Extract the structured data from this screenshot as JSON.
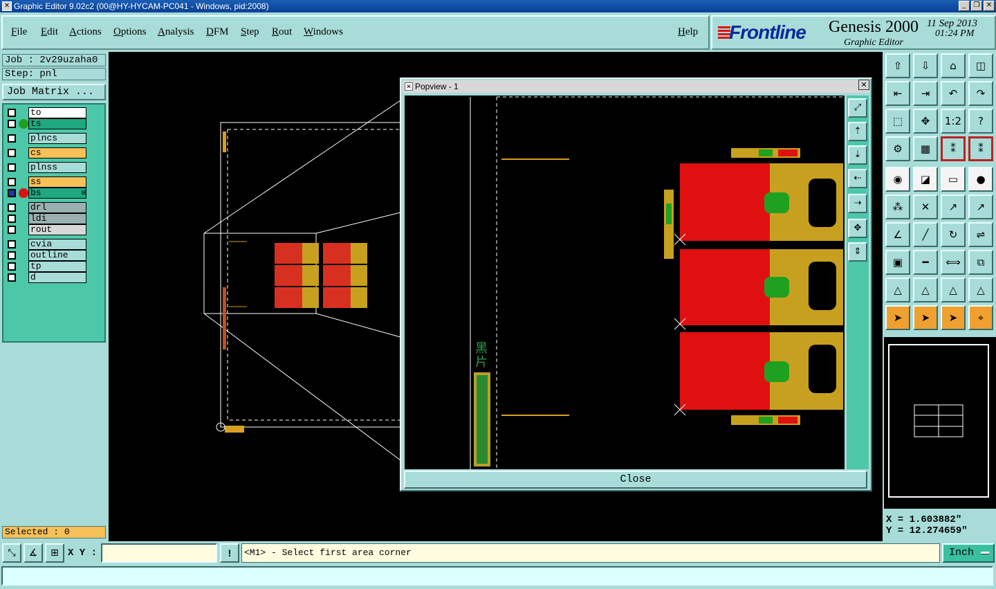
{
  "window": {
    "title": "Graphic Editor 9.02c2 (00@HY-HYCAM-PC041 - Windows, pid:2008)",
    "minimize": "_",
    "restore": "❐",
    "close": "✕"
  },
  "menu": {
    "items": [
      "File",
      "Edit",
      "Actions",
      "Options",
      "Analysis",
      "DFM",
      "Step",
      "Rout",
      "Windows"
    ],
    "help": "Help"
  },
  "logo": {
    "brand": "Frontline",
    "product": "Genesis 2000",
    "subtitle": "Graphic Editor",
    "date": "11 Sep 2013",
    "time": "01:24 PM"
  },
  "job": {
    "job_label": "Job : 2v29uzaha0",
    "step_label": "Step: pnl",
    "matrix_button": "Job Matrix ..."
  },
  "layers": [
    {
      "name": "to",
      "color": "#ffffff",
      "dot": ""
    },
    {
      "name": "ts",
      "color": "#20a880",
      "dot": "#20a020"
    },
    {
      "name": "plncs",
      "color": "#a8dcd8",
      "dot": ""
    },
    {
      "name": "cs",
      "color": "#f8c058",
      "dot": ""
    },
    {
      "name": "plnss",
      "color": "#a8dcd8",
      "dot": ""
    },
    {
      "name": "ss",
      "color": "#f8c058",
      "dot": ""
    },
    {
      "name": "bs",
      "color": "#20a880",
      "dot": "#e01010",
      "mark": "⊞"
    },
    {
      "name": "drl",
      "color": "#9ab0b0",
      "dot": ""
    },
    {
      "name": "ldi",
      "color": "#9ab0b0",
      "dot": ""
    },
    {
      "name": "rout",
      "color": "#d8d8d8",
      "dot": ""
    },
    {
      "name": "cvia",
      "color": "#a8dcd8",
      "dot": ""
    },
    {
      "name": "outline",
      "color": "#a8dcd8",
      "dot": ""
    },
    {
      "name": "tp",
      "color": "#a8dcd8",
      "dot": ""
    },
    {
      "name": "d",
      "color": "#a8dcd8",
      "dot": ""
    }
  ],
  "selected": "Selected : 0",
  "popview": {
    "title": "Popview - 1",
    "close_x": "✕",
    "close_button": "Close",
    "chinese_text": "黑片",
    "side_icons": [
      "zoom-fit",
      "zoom-in",
      "zoom-out",
      "pan-left",
      "pan-right",
      "fit-all",
      "fit-vertical"
    ]
  },
  "toolbox": {
    "icons": [
      "export",
      "import",
      "home",
      "window",
      "move-left",
      "move-right",
      "undo-step",
      "redo-step",
      "zoom-box",
      "zoom-center",
      "ratio",
      "help",
      "settings",
      "grid",
      "snap-a",
      "snap-b",
      "feature-add",
      "measure-draw",
      "ruler",
      "point",
      "node-edit",
      "cross",
      "arc-add",
      "arc-edit",
      "line-draw",
      "line-cut",
      "rotate",
      "mirror",
      "pad-add",
      "line-center",
      "dimension",
      "group",
      "triangle-a",
      "triangle-b",
      "triangle-c",
      "triangle-d",
      "select",
      "select-box",
      "select-poly",
      "select-net"
    ],
    "ratio_label": "1:2"
  },
  "coords": {
    "x": "X = 1.603882\"",
    "y": "Y = 12.274659\""
  },
  "bottom": {
    "xy_label": "X Y :",
    "xy_value": "",
    "warn": "!",
    "prompt": "<M1> - Select first area corner",
    "unit": "Inch",
    "status": ""
  }
}
